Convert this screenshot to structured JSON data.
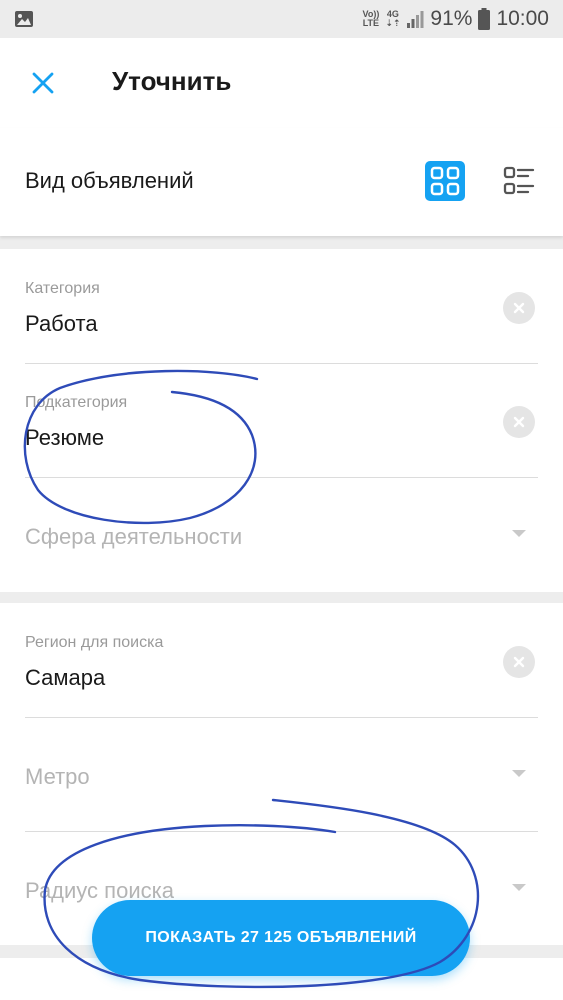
{
  "status_bar": {
    "volte_top": "Vo))",
    "volte_bottom": "LTE",
    "net_top": "4G",
    "net_bottom": "⇣⇡",
    "battery": "91%",
    "time": "10:00"
  },
  "header": {
    "title": "Уточнить",
    "close_icon": "close-icon"
  },
  "view_mode": {
    "label": "Вид объявлений",
    "options": [
      "grid-icon",
      "list-icon"
    ],
    "selected": "grid-icon"
  },
  "category_section": {
    "category": {
      "label": "Категория",
      "value": "Работа"
    },
    "subcategory": {
      "label": "Подкатегория",
      "value": "Резюме"
    },
    "sphere": {
      "placeholder": "Сфера деятельности"
    }
  },
  "location_section": {
    "region": {
      "label": "Регион для поиска",
      "value": "Самара"
    },
    "metro": {
      "placeholder": "Метро"
    },
    "radius": {
      "placeholder": "Радиус поиска"
    }
  },
  "actions": {
    "show_button": "ПОКАЗАТЬ 27 125 ОБЪЯВЛЕНИЙ"
  },
  "colors": {
    "accent": "#15a2f2",
    "annotation": "#2e4bb8"
  }
}
